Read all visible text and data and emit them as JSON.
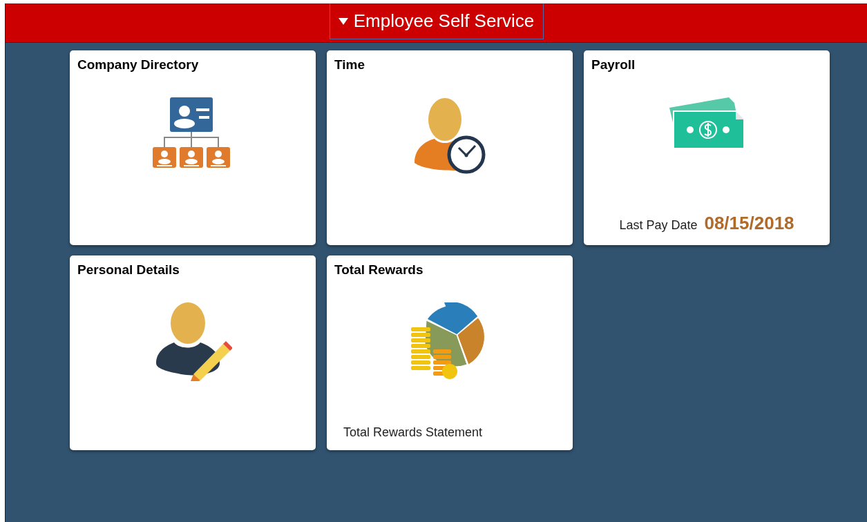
{
  "header": {
    "title": "Employee Self Service"
  },
  "tiles": [
    {
      "title": "Company Directory",
      "kind": "directory"
    },
    {
      "title": "Time",
      "kind": "time"
    },
    {
      "title": "Payroll",
      "kind": "payroll",
      "footer_label": "Last Pay Date",
      "footer_value": "08/15/2018"
    },
    {
      "title": "Personal Details",
      "kind": "personal"
    },
    {
      "title": "Total Rewards",
      "kind": "rewards",
      "footer_text": "Total Rewards Statement"
    }
  ]
}
